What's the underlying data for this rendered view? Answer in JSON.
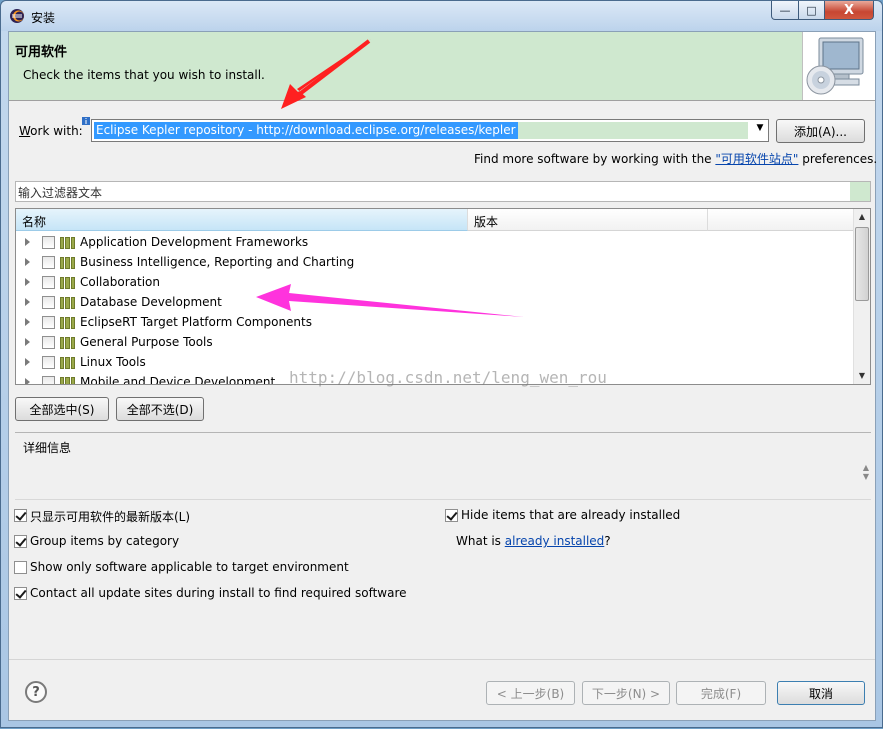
{
  "window": {
    "title": "安装",
    "min": "—",
    "max": "□",
    "close": "X"
  },
  "header": {
    "title": "可用软件",
    "subtitle": "Check the items that you wish to install."
  },
  "work_with": {
    "label_prefix": "W",
    "label_rest": "ork with:",
    "value": "Eclipse Kepler repository - http://download.eclipse.org/releases/kepler",
    "add_button": "添加(A)..."
  },
  "find_more": {
    "prefix": "Find more software by working with the ",
    "link": "\"可用软件站点\"",
    "suffix": " preferences."
  },
  "filter": {
    "placeholder": "输入过滤器文本"
  },
  "tree": {
    "columns": [
      "名称",
      "版本"
    ],
    "items": [
      "Application Development Frameworks",
      "Business Intelligence, Reporting and Charting",
      "Collaboration",
      "Database Development",
      "EclipseRT Target Platform Components",
      "General Purpose Tools",
      "Linux Tools",
      "Mobile and Device Development"
    ]
  },
  "watermark": "http://blog.csdn.net/leng_wen_rou",
  "selection_buttons": {
    "select_all": "全部选中(S)",
    "deselect_all": "全部不选(D)"
  },
  "details": {
    "label": "详细信息"
  },
  "options": {
    "latest_only": {
      "label": "只显示可用软件的最新版本(L)",
      "checked": true
    },
    "group_by_category": {
      "label": "Group items by category",
      "checked": true
    },
    "target_env": {
      "label": "Show only software applicable to target environment",
      "checked": false
    },
    "contact_sites": {
      "label": "Contact all update sites during install to find required software",
      "checked": true
    },
    "hide_installed": {
      "label": "Hide items that are already installed",
      "checked": true
    },
    "what_is": {
      "prefix": "What is ",
      "link": "already installed",
      "suffix": "?"
    }
  },
  "footer": {
    "help": "?",
    "back": "< 上一步(B)",
    "next": "下一步(N) >",
    "finish": "完成(F)",
    "cancel": "取消"
  }
}
